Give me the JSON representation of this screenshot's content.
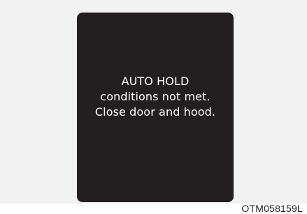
{
  "display": {
    "lines": [
      "AUTO HOLD",
      "conditions not met.",
      "Close door and hood."
    ]
  },
  "figure_code": "OTM058159L"
}
